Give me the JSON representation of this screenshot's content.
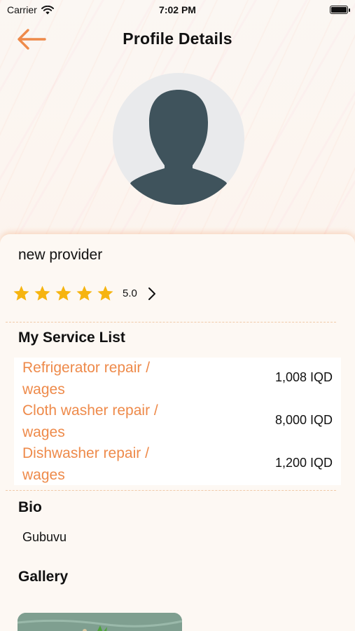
{
  "status_bar": {
    "carrier": "Carrier",
    "time": "7:02 PM"
  },
  "header": {
    "title": "Profile Details",
    "back_icon": "back-arrow-icon"
  },
  "profile": {
    "name": "new provider",
    "rating": 5,
    "rating_label": "5.0",
    "avatar_icon": "person-silhouette-icon"
  },
  "services": {
    "title": "My Service List",
    "items": [
      {
        "name": "Refrigerator repair / wages",
        "price": "1,008 IQD"
      },
      {
        "name": "Cloth washer repair  / wages",
        "price": "8,000 IQD"
      },
      {
        "name": "Dishwasher repair / wages",
        "price": "1,200 IQD"
      }
    ]
  },
  "bio": {
    "title": "Bio",
    "text": "Gubuvu"
  },
  "gallery": {
    "title": "Gallery"
  },
  "colors": {
    "accent": "#ee8a4a",
    "star": "#f6b40f",
    "avatar_bg": "#e9eaec",
    "avatar_fg": "#3f535c"
  }
}
